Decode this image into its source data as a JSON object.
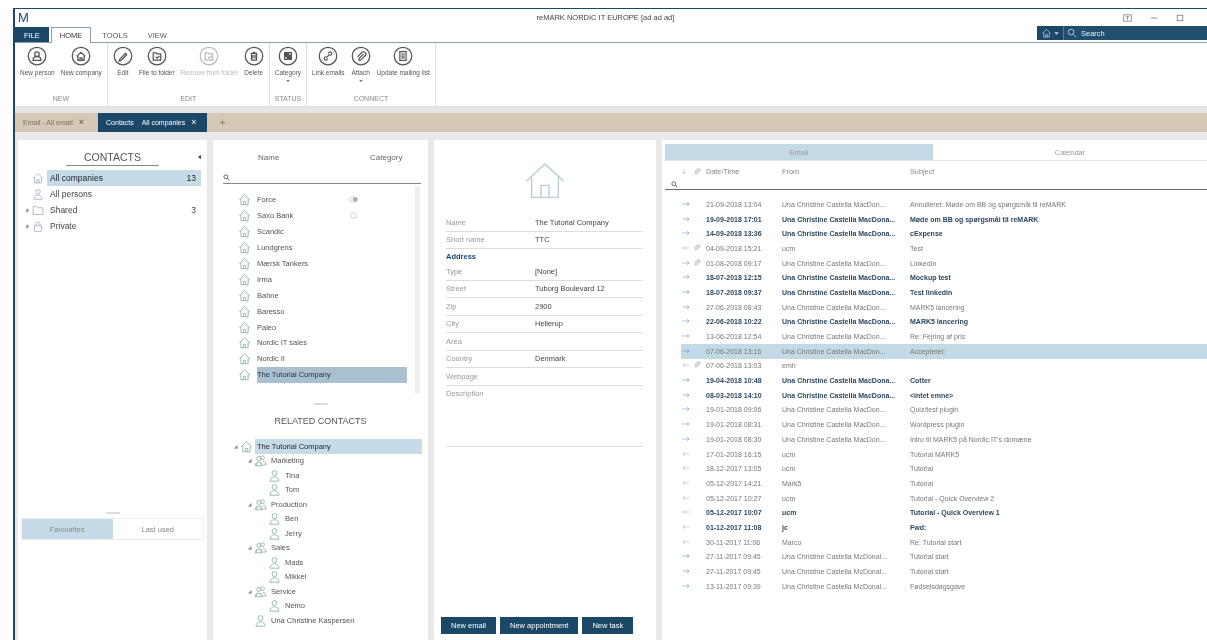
{
  "window": {
    "logo": "M",
    "title": "reMARK NORDIC IT EUROPE [ad ad ad]"
  },
  "menu_tabs": [
    {
      "label": "FILE",
      "kind": "backstage",
      "selected": false
    },
    {
      "label": "HOME",
      "kind": "tab",
      "selected": true
    },
    {
      "label": "TOOLS",
      "kind": "tab",
      "selected": false
    },
    {
      "label": "VIEW",
      "kind": "tab",
      "selected": false
    }
  ],
  "search": {
    "placeholder": "Search"
  },
  "ribbon": {
    "groups": [
      {
        "label": "NEW",
        "buttons": [
          {
            "label": "New person",
            "kind": "person",
            "disabled": false,
            "dropdown": false
          },
          {
            "label": "New company",
            "kind": "company",
            "disabled": false,
            "dropdown": false
          }
        ]
      },
      {
        "label": "EDIT",
        "buttons": [
          {
            "label": "Edit",
            "kind": "edit",
            "disabled": false,
            "dropdown": false
          },
          {
            "label": "File to folder",
            "kind": "folder",
            "disabled": false,
            "dropdown": false
          },
          {
            "label": "Remove from folder",
            "kind": "folder",
            "disabled": true,
            "dropdown": false
          },
          {
            "label": "Delete",
            "kind": "delete",
            "disabled": false,
            "dropdown": false
          }
        ]
      },
      {
        "label": "STATUS",
        "buttons": [
          {
            "label": "Category",
            "kind": "category",
            "disabled": false,
            "dropdown": true
          }
        ]
      },
      {
        "label": "CONNECT",
        "buttons": [
          {
            "label": "Link emails",
            "kind": "link",
            "disabled": false,
            "dropdown": false
          },
          {
            "label": "Attach",
            "kind": "attach",
            "disabled": false,
            "dropdown": true
          },
          {
            "label": "Update mailing list",
            "kind": "list",
            "disabled": false,
            "dropdown": false
          }
        ]
      }
    ]
  },
  "document_tabs": {
    "tabs": [
      {
        "title": "Email - All email",
        "close": "×",
        "selected": false
      },
      {
        "title": "Contacts",
        "subtitle": "All companies",
        "close": "×",
        "selected": true
      }
    ],
    "add": "+"
  },
  "contacts": {
    "title": "CONTACTS",
    "items": [
      {
        "label": "All companies",
        "kind": "company",
        "count": "13",
        "selected": true
      },
      {
        "label": "All persons",
        "kind": "person",
        "selected": false
      },
      {
        "label": "Shared",
        "kind": "folder",
        "count": "3",
        "expanded": false,
        "selected": false
      },
      {
        "label": "Private",
        "kind": "lock",
        "expanded": false,
        "selected": false
      }
    ],
    "bottom_tabs": [
      {
        "label": "Favourites",
        "selected": true
      },
      {
        "label": "Last used",
        "selected": false
      }
    ]
  },
  "companies": {
    "columns": [
      "Name",
      "Category"
    ],
    "rows": [
      {
        "name": "Force",
        "category": {
          "kind": "toggle"
        },
        "selected": false
      },
      {
        "name": "Saxo Bank",
        "category": {
          "kind": "circle"
        },
        "selected": false
      },
      {
        "name": "Scandic",
        "selected": false
      },
      {
        "name": "Lundgrens",
        "selected": false
      },
      {
        "name": "Mærsk Tankers",
        "selected": false
      },
      {
        "name": "Irma",
        "selected": false
      },
      {
        "name": "Bahne",
        "selected": false
      },
      {
        "name": "Baresso",
        "selected": false
      },
      {
        "name": "Paleo",
        "selected": false
      },
      {
        "name": "Nordic IT sales",
        "selected": false
      },
      {
        "name": "Nordic II",
        "selected": false
      },
      {
        "name": "The Tutorial Company",
        "selected": true
      }
    ]
  },
  "related_contacts": {
    "title": "RELATED CONTACTS",
    "tree": [
      {
        "label": "The Tutorial Company",
        "kind": "company",
        "selected": true,
        "expanded": true,
        "children": [
          {
            "label": "Marketing",
            "kind": "group",
            "selected": false,
            "expanded": true,
            "children": [
              {
                "label": "Tina",
                "kind": "person",
                "selected": false
              },
              {
                "label": "Tom",
                "kind": "person",
                "selected": false
              }
            ]
          },
          {
            "label": "Production",
            "kind": "group",
            "selected": false,
            "expanded": true,
            "children": [
              {
                "label": "Ben",
                "kind": "person",
                "selected": false
              },
              {
                "label": "Jerry",
                "kind": "person",
                "selected": false
              }
            ]
          },
          {
            "label": "Sales",
            "kind": "group",
            "selected": false,
            "expanded": true,
            "children": [
              {
                "label": "Mads",
                "kind": "person",
                "selected": false
              },
              {
                "label": "Mikkel",
                "kind": "person",
                "selected": false
              }
            ]
          },
          {
            "label": "Service",
            "kind": "group",
            "selected": false,
            "expanded": true,
            "children": [
              {
                "label": "Nemo",
                "kind": "person",
                "selected": false
              }
            ]
          },
          {
            "label": "Una Christine Kaspersen",
            "kind": "person",
            "selected": false
          }
        ]
      }
    ]
  },
  "detail": {
    "fields": [
      {
        "kind": "field",
        "label": "Name",
        "value": "The Tutorial Company"
      },
      {
        "kind": "field",
        "label": "Short name",
        "value": "TTC"
      },
      {
        "kind": "heading",
        "label": "Address"
      },
      {
        "kind": "field",
        "label": "Type",
        "value": "[None]"
      },
      {
        "kind": "field",
        "label": "Street",
        "value": "Tuborg Boulevard 12"
      },
      {
        "kind": "field",
        "label": "Zip",
        "value": "2900"
      },
      {
        "kind": "field",
        "label": "City",
        "value": "Hellerup"
      },
      {
        "kind": "field",
        "label": "Area"
      },
      {
        "kind": "field",
        "label": "Country",
        "value": "Denmark"
      },
      {
        "kind": "field",
        "label": "Webpage"
      },
      {
        "kind": "textarea",
        "label": "Description"
      }
    ],
    "buttons": [
      "New email",
      "New appointment",
      "New task"
    ]
  },
  "email": {
    "tabs": [
      {
        "label": "Email",
        "selected": true
      },
      {
        "label": "Calendar",
        "selected": false
      }
    ],
    "columns": [
      "Date/Time",
      "From",
      "Subject"
    ],
    "rows": [
      {
        "kind": "outgoing",
        "attachment": false,
        "unread": false,
        "selected": false,
        "date": "21-09-2018 13:04",
        "from": "Una Christine Castella MacDon...",
        "subject": "Annulleret: Møde om BB og spørgsmål til reMARK"
      },
      {
        "kind": "outgoing",
        "attachment": false,
        "unread": true,
        "selected": false,
        "date": "19-09-2018 17:01",
        "from": "Una Christine Castella MacDona...",
        "subject": "Møde om BB og spørgsmål til reMARK"
      },
      {
        "kind": "outgoing",
        "attachment": false,
        "unread": true,
        "selected": false,
        "date": "14-09-2018 13:36",
        "from": "Una Christine Castella MacDona...",
        "subject": "cExpense"
      },
      {
        "kind": "incoming",
        "attachment": true,
        "unread": false,
        "selected": false,
        "date": "04-09-2018 15:21",
        "from": "ucm",
        "subject": "Test"
      },
      {
        "kind": "outgoing",
        "attachment": true,
        "unread": false,
        "selected": false,
        "date": "01-08-2018 09:17",
        "from": "Una Christine Castella MacDon...",
        "subject": "LinkedIn"
      },
      {
        "kind": "outgoing",
        "attachment": false,
        "unread": true,
        "selected": false,
        "date": "18-07-2018 12:15",
        "from": "Una Christine Castella MacDona...",
        "subject": "Mockup test"
      },
      {
        "kind": "outgoing",
        "attachment": false,
        "unread": true,
        "selected": false,
        "date": "18-07-2018 09:37",
        "from": "Una Christine Castella MacDona...",
        "subject": "Test linkedin"
      },
      {
        "kind": "outgoing",
        "attachment": false,
        "unread": false,
        "selected": false,
        "date": "27-06-2018 08:43",
        "from": "Una Christine Castella MacDon...",
        "subject": "MARK5 lancering"
      },
      {
        "kind": "outgoing",
        "attachment": false,
        "unread": true,
        "selected": false,
        "date": "22-06-2018 10:22",
        "from": "Una Christine Castella MacDona...",
        "subject": "MARK5 lancering"
      },
      {
        "kind": "outgoing",
        "attachment": false,
        "unread": false,
        "selected": false,
        "date": "13-06-2018 12:54",
        "from": "Una Christine Castella MacDon...",
        "subject": "Re: Fejring af pris"
      },
      {
        "kind": "outgoing",
        "attachment": false,
        "unread": false,
        "selected": true,
        "date": "07-06-2018 13:16",
        "from": "Una Christine Castella MacDon...",
        "subject": "Accepteret:"
      },
      {
        "kind": "incoming",
        "attachment": true,
        "unread": false,
        "selected": false,
        "date": "07-06-2018 13:03",
        "from": "emh"
      },
      {
        "kind": "outgoing",
        "attachment": false,
        "unread": true,
        "selected": false,
        "date": "19-04-2018 10:48",
        "from": "Una Christine Castella MacDona...",
        "subject": "Cotter"
      },
      {
        "kind": "outgoing",
        "attachment": false,
        "unread": true,
        "selected": false,
        "date": "08-03-2018 14:10",
        "from": "Una Christine Castella MacDona...",
        "subject": "<intet emne>"
      },
      {
        "kind": "outgoing",
        "attachment": false,
        "unread": false,
        "selected": false,
        "date": "19-01-2018 09:06",
        "from": "Una Christine Castella MacDon...",
        "subject": "Quiz/test plugin"
      },
      {
        "kind": "outgoing",
        "attachment": false,
        "unread": false,
        "selected": false,
        "date": "19-01-2018 08:31",
        "from": "Una Christine Castella MacDon...",
        "subject": "Wordpress plugin"
      },
      {
        "kind": "outgoing",
        "attachment": false,
        "unread": false,
        "selected": false,
        "date": "19-01-2018 08:30",
        "from": "Una Christine Castella MacDon...",
        "subject": "Intro til MARK5 på Nordic IT's domæne"
      },
      {
        "kind": "incoming",
        "attachment": false,
        "unread": false,
        "selected": false,
        "date": "17-01-2018 16:15",
        "from": "ucm",
        "subject": "Tutorial MARK5"
      },
      {
        "kind": "incoming",
        "attachment": false,
        "unread": false,
        "selected": false,
        "date": "18-12-2017 13:05",
        "from": "ucm",
        "subject": "Tutorial"
      },
      {
        "kind": "incoming",
        "attachment": false,
        "unread": false,
        "selected": false,
        "date": "05-12-2017 14:21",
        "from": "Mark5",
        "subject": "Tutorial"
      },
      {
        "kind": "incoming",
        "attachment": false,
        "unread": false,
        "selected": false,
        "date": "05-12-2017 10:27",
        "from": "ucm",
        "subject": "Tutorial - Quick Overview 2"
      },
      {
        "kind": "incoming",
        "attachment": false,
        "unread": true,
        "selected": false,
        "date": "05-12-2017 10:07",
        "from": "ucm",
        "subject": "Tutorial - Quick Overview 1"
      },
      {
        "kind": "incoming",
        "attachment": false,
        "unread": true,
        "selected": false,
        "date": "01-12-2017 11:08",
        "from": "jc",
        "subject": "Fwd:"
      },
      {
        "kind": "incoming",
        "attachment": false,
        "unread": false,
        "selected": false,
        "date": "30-11-2017 11:06",
        "from": "Marco",
        "subject": "Re: Tutorial start"
      },
      {
        "kind": "outgoing",
        "attachment": false,
        "unread": false,
        "selected": false,
        "date": "27-11-2017 09:45",
        "from": "Una Christine Castella McDonal...",
        "subject": "Tutorial start"
      },
      {
        "kind": "outgoing",
        "attachment": false,
        "unread": false,
        "selected": false,
        "date": "27-11-2017 09:45",
        "from": "Una Christine Castella McDonal...",
        "subject": "Tutorial start"
      },
      {
        "kind": "outgoing",
        "attachment": false,
        "unread": false,
        "selected": false,
        "date": "13-11-2017 09:39",
        "from": "Una Christine Castella McDonal...",
        "subject": "Fødselsdagsgave"
      }
    ]
  }
}
